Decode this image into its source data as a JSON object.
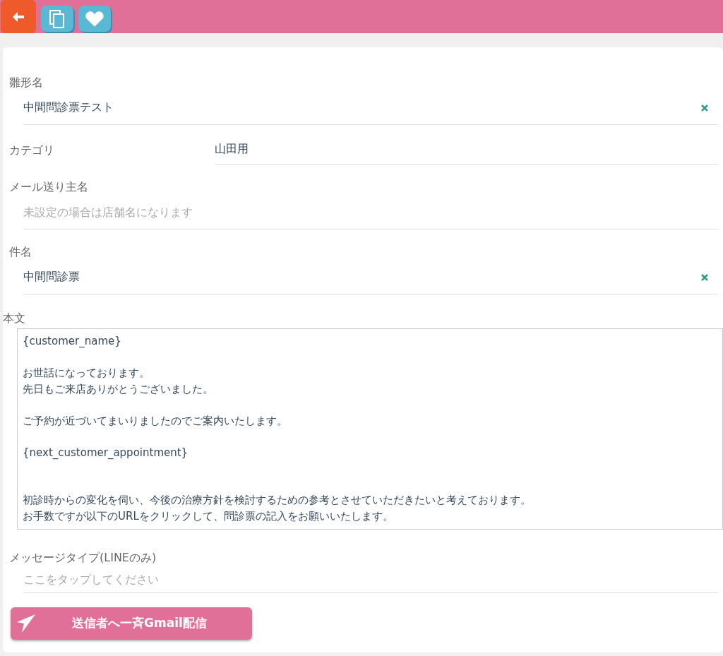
{
  "toolbar": {
    "buttons": [
      {
        "kind": "back"
      },
      {
        "kind": "copy"
      },
      {
        "kind": "favorite"
      }
    ]
  },
  "fields": [
    {
      "kind": "text",
      "label": "雛形名",
      "value": "中間問診票テスト",
      "clearable": true
    },
    {
      "kind": "select",
      "label": "カテゴリ",
      "value": "山田用"
    },
    {
      "kind": "text",
      "label": "メール送り主名",
      "placeholder": "未設定の場合は店舗名になります",
      "clearable": false
    },
    {
      "kind": "text",
      "label": "件名",
      "value": "中間問診票",
      "clearable": true
    }
  ],
  "body": {
    "label": "本文",
    "paragraphs": [
      {
        "lines": [
          "{customer_name}"
        ]
      },
      {
        "lines": [
          "お世話になっております。",
          "先日もご来店ありがとうございました。"
        ]
      },
      {
        "lines": [
          "ご予約が近づいてまいりましたのでご案内いたします。"
        ]
      },
      {
        "lines": [
          "{next_customer_appointment}"
        ]
      },
      {
        "lines": [
          "初診時からの変化を伺い、今後の治療方針を検討するための参考とさせていただきたいと考えております。",
          "お手数ですが以下のURLをクリックして、問診票の記入をお願いいたします。"
        ]
      }
    ]
  },
  "message_type": {
    "label": "メッセージタイプ(LINEのみ)",
    "placeholder": "ここをタップしてください"
  },
  "send_button": {
    "label": "送信者へ一斉Gmail配信"
  }
}
